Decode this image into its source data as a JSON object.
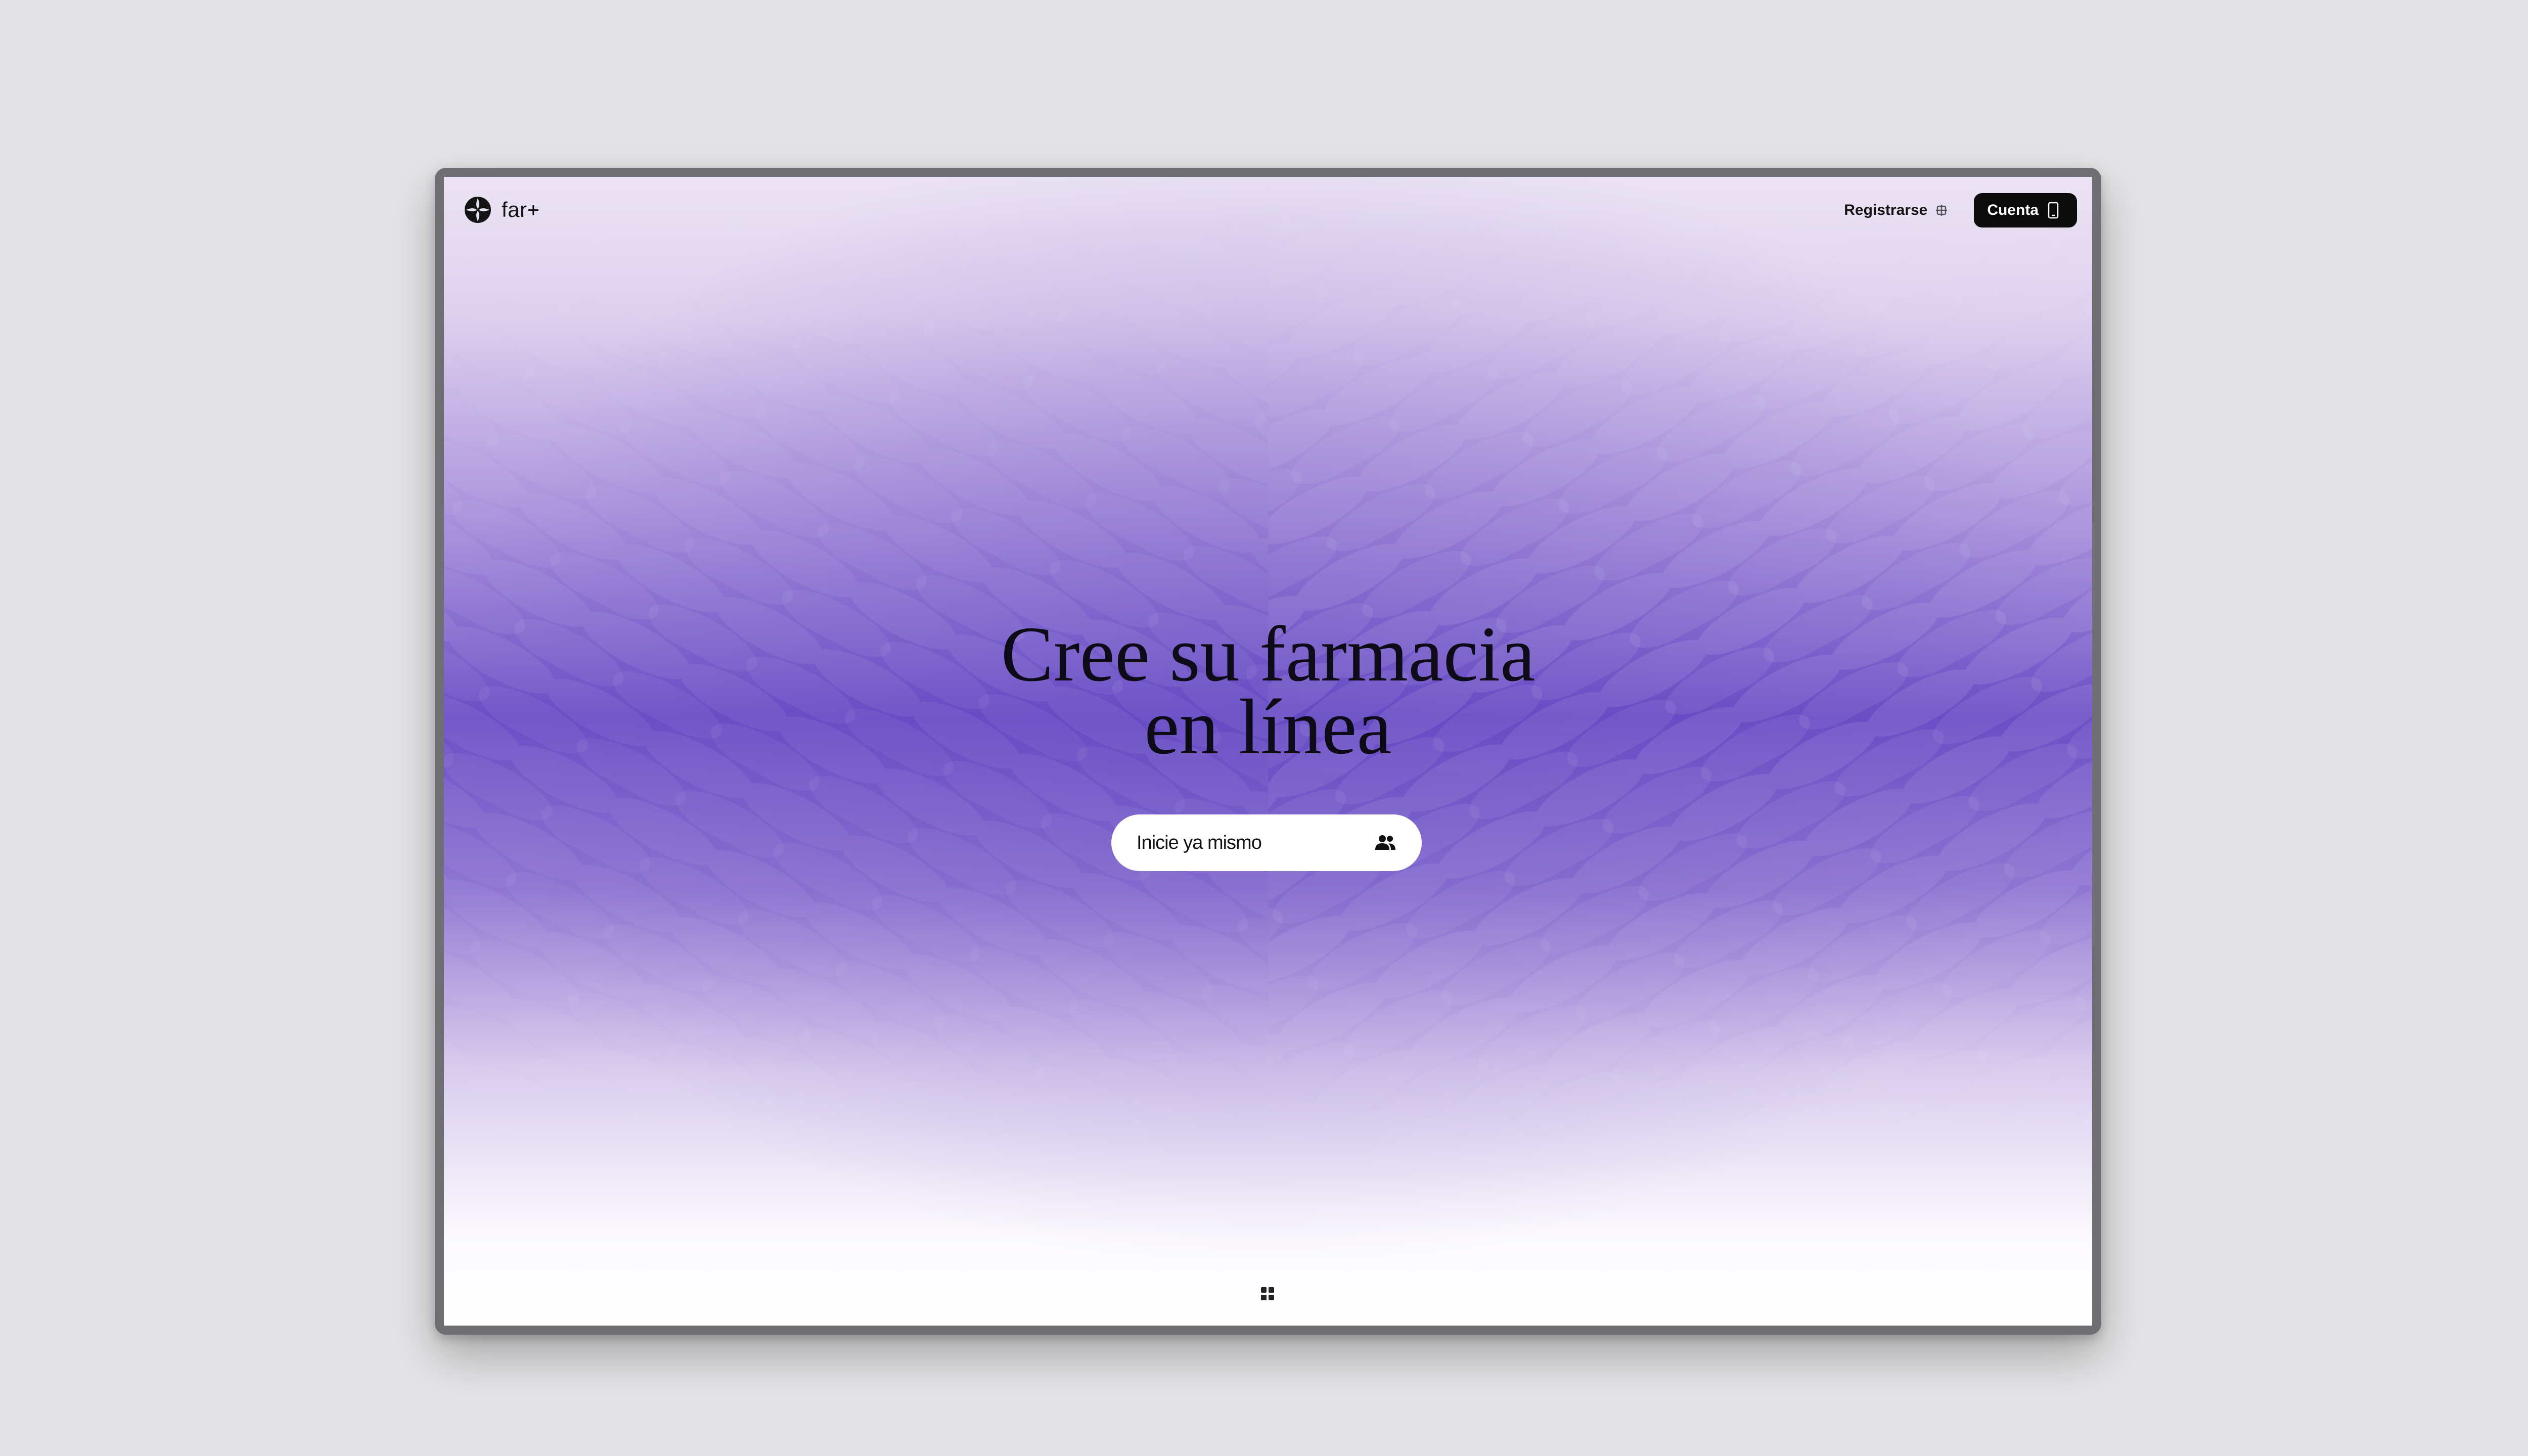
{
  "brand": {
    "name": "far+",
    "logo_icon": "flower-logo-icon"
  },
  "nav": {
    "register_label": "Registrarse",
    "register_icon": "plus-grid-icon",
    "account_label": "Cuenta",
    "account_icon": "phone-icon"
  },
  "hero": {
    "title_line1": "Cree su farmacia",
    "title_line2": "en línea",
    "cta_label": "Inicie ya mismo",
    "cta_icon": "users-icon"
  },
  "footer": {
    "icon": "grid-icon"
  },
  "colors": {
    "accent_purple": "#6a4fc6",
    "light_lavender": "#ece4f4",
    "button_dark": "#0b0b0c"
  }
}
